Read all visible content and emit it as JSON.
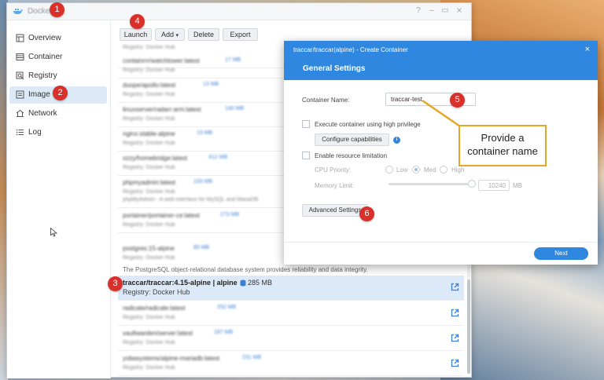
{
  "window": {
    "title": "Docker",
    "controls": {
      "help": "?",
      "minimize": "–",
      "maximize": "▭",
      "close": "×"
    }
  },
  "sidebar": {
    "items": [
      {
        "label": "Overview",
        "icon": "overview-icon"
      },
      {
        "label": "Container",
        "icon": "container-icon"
      },
      {
        "label": "Registry",
        "icon": "registry-icon"
      },
      {
        "label": "Image",
        "icon": "image-icon",
        "active": true
      },
      {
        "label": "Network",
        "icon": "network-icon"
      },
      {
        "label": "Log",
        "icon": "log-icon"
      }
    ]
  },
  "toolbar": {
    "launch": "Launch",
    "add": "Add",
    "add_caret": "▾",
    "delete": "Delete",
    "export": "Export"
  },
  "image_list": {
    "rows": [
      {
        "name": "containrrr/watchtower:latest",
        "size": "17 MB",
        "sub": "Registry: Docker Hub"
      },
      {
        "name": "duope/apollo:latest",
        "size": "13 MB",
        "sub": "Registry: Docker Hub"
      },
      {
        "name": "linuxserver/radarr:arm:latest",
        "size": "140 MB",
        "sub": "Registry: Docker Hub"
      },
      {
        "name": "nginx:stable-alpine",
        "size": "13 MB",
        "sub": "Registry: Docker Hub"
      },
      {
        "name": "ozzy/homebridge:latest",
        "size": "412 MB",
        "sub": "Registry: Docker Hub"
      },
      {
        "name": "phpmyadmin:latest",
        "size": "133 MB",
        "sub": "Registry: Docker Hub",
        "desc": "phpMyAdmin - A web interface for MySQL and MariaDB"
      },
      {
        "name": "portainer/portainer-ce:latest",
        "size": "273 MB",
        "sub": "Registry: Docker Hub"
      },
      {
        "name": "postgres:15-alpine",
        "size": "80 MB",
        "sub": "Registry: Docker Hub"
      },
      {
        "name": "traccar/traccar:4.15-alpine | alpine",
        "size": "285 MB",
        "sub": "Registry: Docker Hub",
        "selected": true
      },
      {
        "name": "radicale/radicale:latest",
        "size": "252 MB",
        "sub": "Registry: Docker Hub"
      },
      {
        "name": "vaultwarden/server:latest",
        "size": "187 MB",
        "sub": "Registry: Docker Hub"
      },
      {
        "name": "yobasystems/alpine-mariadb:latest",
        "size": "231 MB",
        "sub": "Registry: Docker Hub"
      }
    ],
    "postgres_description": "The PostgreSQL object-relational database system provides reliability and data integrity."
  },
  "dialog": {
    "title": "traccar/traccar(alpine) - Create Container",
    "close": "×",
    "heading": "General Settings",
    "container_name_label": "Container Name:",
    "container_name_value": "traccar-test",
    "high_privilege_label": "Execute container using high privilege",
    "configure_capabilities": "Configure capabilities",
    "info_glyph": "i",
    "resource_limit_label": "Enable resource limitation",
    "cpu_priority_label": "CPU Priority:",
    "cpu_low": "Low",
    "cpu_med": "Med",
    "cpu_high": "High",
    "memory_limit_label": "Memory Limit:",
    "memory_value": "10240",
    "memory_unit": "MB",
    "advanced_settings": "Advanced Settings",
    "next": "Next"
  },
  "annotations": {
    "badges": [
      "1",
      "2",
      "3",
      "4",
      "5",
      "6"
    ],
    "callout": "Provide a container name",
    "badge_color": "#d9302a",
    "callout_border_color": "#e5a72a"
  },
  "colors": {
    "accent": "#2f87e0",
    "selected_row": "#dbe9f8"
  }
}
